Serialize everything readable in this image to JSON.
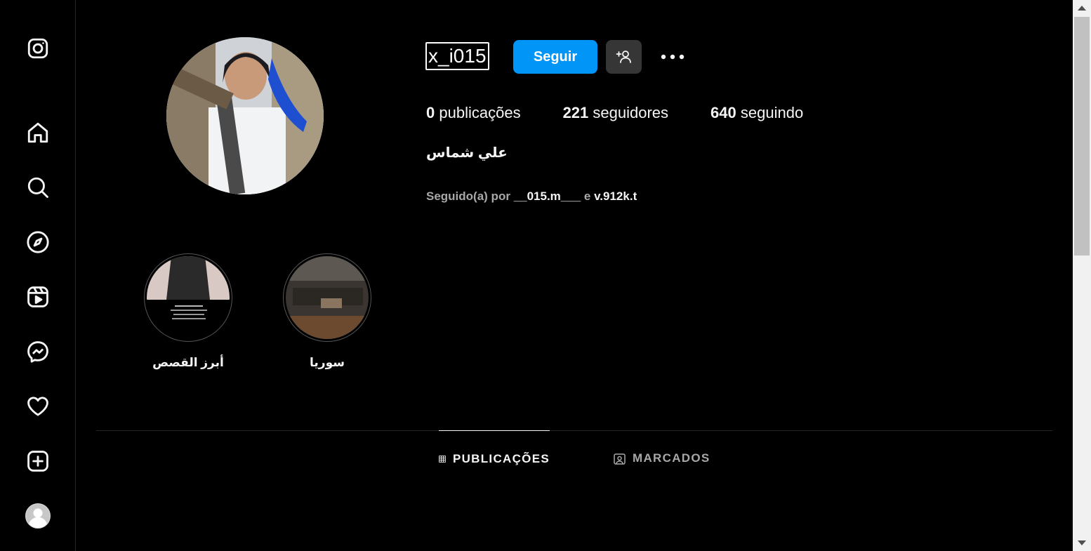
{
  "sidebar": {
    "items": [
      {
        "name": "instagram-logo"
      },
      {
        "name": "home"
      },
      {
        "name": "search"
      },
      {
        "name": "explore"
      },
      {
        "name": "reels"
      },
      {
        "name": "messenger"
      },
      {
        "name": "notifications"
      },
      {
        "name": "create"
      },
      {
        "name": "profile"
      }
    ]
  },
  "profile": {
    "username": "x_i015",
    "follow_label": "Seguir",
    "stats": {
      "posts_count": "0",
      "posts_label": "publicações",
      "followers_count": "221",
      "followers_label": "seguidores",
      "following_count": "640",
      "following_label": "seguindo"
    },
    "full_name": "علي شماس",
    "followed_by": {
      "prefix": "Seguido(a) por",
      "user1": "__015.m___",
      "joiner": "e",
      "user2": "v.912k.t"
    }
  },
  "highlights": [
    {
      "label": "أبرز القصص"
    },
    {
      "label": "سوريا"
    }
  ],
  "tabs": [
    {
      "label": "PUBLICAÇÕES",
      "active": true
    },
    {
      "label": "MARCADOS",
      "active": false
    }
  ],
  "colors": {
    "background": "#000000",
    "accent": "#0095f6",
    "secondary_button": "#363636"
  }
}
